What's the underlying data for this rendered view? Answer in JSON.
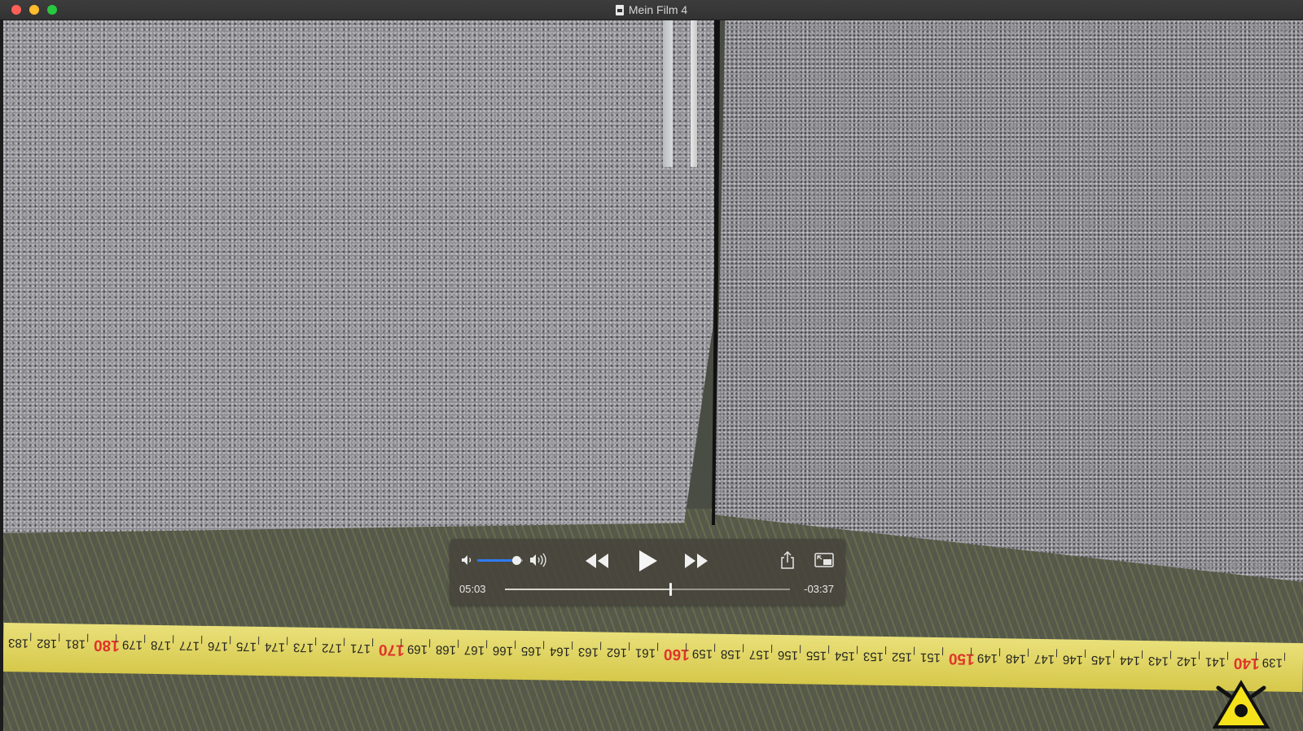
{
  "window": {
    "title": "Mein Film 4"
  },
  "player": {
    "current_time": "05:03",
    "remaining_time": "-03:37",
    "progress": 0.58,
    "volume": 0.85,
    "accent_color": "#2f7bf5"
  },
  "icons": {
    "volume_low": "speaker-low-icon",
    "volume_high": "speaker-high-icon",
    "rewind": "rewind-icon",
    "play": "play-icon",
    "fast_forward": "fast-forward-icon",
    "share": "share-icon",
    "pip": "picture-in-picture-icon",
    "logo": "warning-triangle-logo"
  },
  "tape": {
    "numbers": [
      "183",
      "182",
      "181",
      "180",
      "179",
      "178",
      "177",
      "176",
      "175",
      "174",
      "173",
      "172",
      "171",
      "170",
      "169",
      "168",
      "167",
      "166",
      "165",
      "164",
      "163",
      "162",
      "161",
      "160",
      "159",
      "158",
      "157",
      "156",
      "155",
      "154",
      "153",
      "152",
      "151",
      "150",
      "149",
      "148",
      "147",
      "146",
      "145",
      "144",
      "143",
      "142",
      "141",
      "140",
      "139"
    ],
    "major_color": "#e0342a"
  }
}
